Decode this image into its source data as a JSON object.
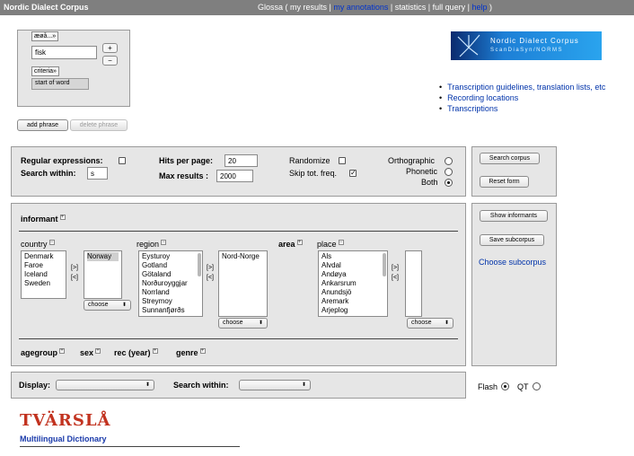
{
  "topbar": {
    "brand": "Nordic Dialect Corpus",
    "nav_prefix": "Glossa ( ",
    "my_results": "my results",
    "sep": " | ",
    "my_annotations": "my annotations",
    "statistics": "statistics",
    "full_query": "full query",
    "help": "help",
    "nav_suffix": " )"
  },
  "query": {
    "special_chars_button": "æøå...»",
    "word_value": "fisk",
    "plus": "+",
    "minus": "−",
    "criteria_button": "criteria»",
    "position_value": "start of word"
  },
  "phrase": {
    "add": "add phrase",
    "delete": "delete phrase"
  },
  "logo": {
    "line1": "Nordic Dialect Corpus",
    "line2": "ScanDiaSyn/NORMS"
  },
  "resources": [
    "Transcription guidelines, translation lists, etc",
    "Recording locations",
    "Transcriptions"
  ],
  "options": {
    "regex_label": "Regular expressions:",
    "search_within_label": "Search within:",
    "search_within_value": "s",
    "hits_label": "Hits per page:",
    "hits_value": "20",
    "max_label": "Max results :",
    "max_value": "2000",
    "randomize_label": "Randomize",
    "skip_label": "Skip tot. freq.",
    "skip_checked": true,
    "orthographic_label": "Orthographic",
    "phonetic_label": "Phonetic",
    "both_label": "Both",
    "selected_tier": "Both"
  },
  "actions": {
    "search_corpus": "Search corpus",
    "reset_form": "Reset form",
    "show_informants": "Show informants",
    "save_subcorpus": "Save subcorpus",
    "choose_subcorpus": "Choose subcorpus"
  },
  "informant": {
    "heading": "informant",
    "country_label": "country",
    "countries": [
      "Denmark",
      "Faroe",
      "Iceland",
      "Sweden"
    ],
    "selected_countries": [
      "Norway"
    ],
    "region_label": "region",
    "regions": [
      "Eysturoy",
      "Gotland",
      "Götaland",
      "Norðuroyggjar",
      "Norrland",
      "Streymoy",
      "Sunnanfjørðs"
    ],
    "selected_regions": [
      "Nord-Norge"
    ],
    "area_label": "area",
    "place_label": "place",
    "places": [
      "Als",
      "Alvdal",
      "Andøya",
      "Ankarsrum",
      "Anundsjö",
      "Aremark",
      "Arjeplog"
    ],
    "choose": "choose",
    "arrow_add": "[>]",
    "arrow_remove": "[<]",
    "agegroup": "agegroup",
    "sex": "sex",
    "rec_year": "rec (year)",
    "genre": "genre"
  },
  "display": {
    "label": "Display:",
    "search_within": "Search within:"
  },
  "player": {
    "flash": "Flash",
    "qt": "QT",
    "selected": "Flash"
  },
  "footer": {
    "tvarsla": "TVÄRSLÅ",
    "dictionary": "Multilingual Dictionary"
  },
  "colors": {
    "topbar": "#7f7f7f",
    "panel": "#e6e6e6",
    "link": "#0033aa",
    "tvarsla": "#c23320"
  }
}
